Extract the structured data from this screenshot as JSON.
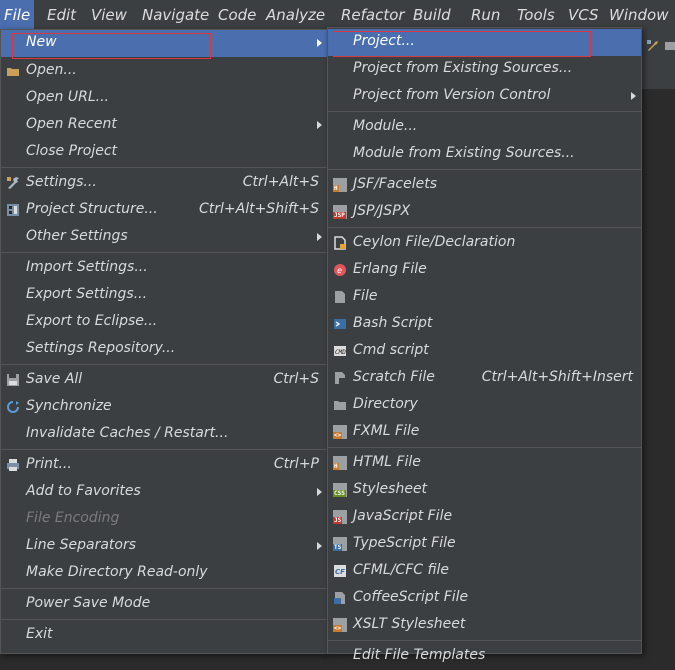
{
  "menubar": [
    "File",
    "Edit",
    "View",
    "Navigate",
    "Code",
    "Analyze",
    "Refactor",
    "Build",
    "Run",
    "Tools",
    "VCS",
    "Window"
  ],
  "file_menu": {
    "new": "New",
    "open": "Open...",
    "open_url": "Open URL...",
    "open_recent": "Open Recent",
    "close_project": "Close Project",
    "settings": "Settings...",
    "settings_shortcut": "Ctrl+Alt+S",
    "project_structure": "Project Structure...",
    "project_structure_shortcut": "Ctrl+Alt+Shift+S",
    "other_settings": "Other Settings",
    "import_settings": "Import Settings...",
    "export_settings": "Export Settings...",
    "export_eclipse": "Export to Eclipse...",
    "settings_repo": "Settings Repository...",
    "save_all": "Save All",
    "save_all_shortcut": "Ctrl+S",
    "synchronize": "Synchronize",
    "invalidate": "Invalidate Caches / Restart...",
    "print": "Print...",
    "print_shortcut": "Ctrl+P",
    "add_favorites": "Add to Favorites",
    "file_encoding": "File Encoding",
    "line_separators": "Line Separators",
    "make_readonly": "Make Directory Read-only",
    "power_save": "Power Save Mode",
    "exit": "Exit"
  },
  "new_menu": {
    "project": "Project...",
    "from_existing": "Project from Existing Sources...",
    "from_vcs": "Project from Version Control",
    "module": "Module...",
    "module_existing": "Module from Existing Sources...",
    "jsf": "JSF/Facelets",
    "jsp": "JSP/JSPX",
    "ceylon": "Ceylon File/Declaration",
    "erlang": "Erlang File",
    "file": "File",
    "bash": "Bash Script",
    "cmd": "Cmd script",
    "scratch": "Scratch File",
    "scratch_shortcut": "Ctrl+Alt+Shift+Insert",
    "directory": "Directory",
    "fxml": "FXML File",
    "html": "HTML File",
    "stylesheet": "Stylesheet",
    "javascript": "JavaScript File",
    "typescript": "TypeScript File",
    "cfml": "CFML/CFC file",
    "coffeescript": "CoffeeScript File",
    "xslt": "XSLT Stylesheet",
    "partial": "Edit File Templates"
  },
  "icons": {
    "open": "folder-icon",
    "settings": "wrench-icon",
    "project_structure": "project-structure-icon",
    "save_all": "save-icon",
    "synchronize": "sync-icon",
    "print": "printer-icon"
  },
  "colors": {
    "selection": "#4b6eaf",
    "menu_bg": "#3c3f41",
    "highlight_box": "#d9383e"
  }
}
